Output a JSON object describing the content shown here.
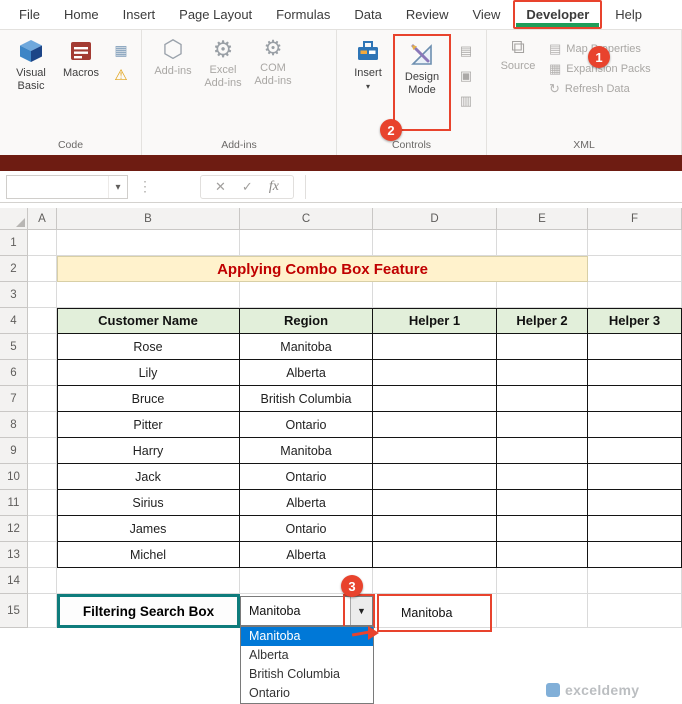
{
  "colors": {
    "accent_red": "#E8432D",
    "excel_green": "#1E9E5A",
    "title_text": "#C00000",
    "title_bg": "#FFF2CC",
    "table_header_bg": "#E2EFDA",
    "selection_blue": "#0078D7",
    "filter_border_teal": "#0E7C7C",
    "window_strip": "#6E1C12"
  },
  "ribbon": {
    "tabs": [
      {
        "label": "File",
        "active": false
      },
      {
        "label": "Home",
        "active": false
      },
      {
        "label": "Insert",
        "active": false
      },
      {
        "label": "Page Layout",
        "active": false
      },
      {
        "label": "Formulas",
        "active": false
      },
      {
        "label": "Data",
        "active": false
      },
      {
        "label": "Review",
        "active": false
      },
      {
        "label": "View",
        "active": false
      },
      {
        "label": "Developer",
        "active": true
      },
      {
        "label": "Help",
        "active": false
      }
    ],
    "groups": [
      {
        "name": "Code",
        "buttons": [
          {
            "label": "Visual Basic",
            "icon": "visual-basic-icon",
            "size": "large",
            "enabled": true
          },
          {
            "label": "Macros",
            "icon": "macros-icon",
            "size": "large",
            "enabled": true
          },
          {
            "label": "",
            "icon": "record-macro-icon",
            "size": "small",
            "enabled": true
          },
          {
            "label": "",
            "icon": "macro-security-icon",
            "size": "small",
            "enabled": true
          }
        ]
      },
      {
        "name": "Add-ins",
        "buttons": [
          {
            "label": "Add-ins",
            "icon": "addins-icon",
            "size": "large",
            "enabled": false
          },
          {
            "label": "Excel Add-ins",
            "icon": "excel-addins-icon",
            "size": "large",
            "enabled": false
          },
          {
            "label": "COM Add-ins",
            "icon": "com-addins-icon",
            "size": "large",
            "enabled": false
          }
        ]
      },
      {
        "name": "Controls",
        "buttons": [
          {
            "label": "Insert",
            "icon": "insert-icon",
            "size": "large",
            "enabled": true,
            "dropdown": true
          },
          {
            "label": "Design Mode",
            "icon": "design-mode-icon",
            "size": "large",
            "enabled": true,
            "highlighted": true
          },
          {
            "label": "",
            "icon": "properties-icon",
            "size": "small",
            "enabled": false
          },
          {
            "label": "",
            "icon": "view-code-icon",
            "size": "small",
            "enabled": false
          },
          {
            "label": "",
            "icon": "run-dialog-icon",
            "size": "small",
            "enabled": false
          }
        ]
      },
      {
        "name": "XML",
        "buttons": [
          {
            "label": "Source",
            "icon": "source-icon",
            "size": "large",
            "enabled": false
          },
          {
            "label": "Map Properties",
            "icon": "map-properties-icon",
            "size": "menu",
            "enabled": false
          },
          {
            "label": "Expansion Packs",
            "icon": "expansion-packs-icon",
            "size": "menu",
            "enabled": false
          },
          {
            "label": "Refresh Data",
            "icon": "refresh-data-icon",
            "size": "menu",
            "enabled": false
          }
        ]
      }
    ]
  },
  "callouts": {
    "step1": "1",
    "step2": "2",
    "step3": "3"
  },
  "formula_bar": {
    "name_box_value": "",
    "cancel": "✕",
    "enter": "✓",
    "fx": "fx",
    "formula_value": ""
  },
  "sheet": {
    "columns": [
      "A",
      "B",
      "C",
      "D",
      "E",
      "F"
    ],
    "row_numbers": [
      1,
      2,
      3,
      4,
      5,
      6,
      7,
      8,
      9,
      10,
      11,
      12,
      13,
      14,
      15
    ],
    "title": "Applying Combo Box Feature",
    "table": {
      "headers": [
        "Customer Name",
        "Region",
        "Helper 1",
        "Helper 2",
        "Helper 3"
      ],
      "rows": [
        [
          "Rose",
          "Manitoba",
          "",
          "",
          ""
        ],
        [
          "Lily",
          "Alberta",
          "",
          "",
          ""
        ],
        [
          "Bruce",
          "British Columbia",
          "",
          "",
          ""
        ],
        [
          "Pitter",
          "Ontario",
          "",
          "",
          ""
        ],
        [
          "Harry",
          "Manitoba",
          "",
          "",
          ""
        ],
        [
          "Jack",
          "Ontario",
          "",
          "",
          ""
        ],
        [
          "Sirius",
          "Alberta",
          "",
          "",
          ""
        ],
        [
          "James",
          "Ontario",
          "",
          "",
          ""
        ],
        [
          "Michel",
          "Alberta",
          "",
          "",
          ""
        ]
      ]
    },
    "filter_label": "Filtering Search Box",
    "combo_box": {
      "value": "Manitoba",
      "options": [
        "Manitoba",
        "Alberta",
        "British Columbia",
        "Ontario"
      ],
      "selected_option": "Manitoba"
    },
    "linked_cell_value": "Manitoba"
  },
  "watermark": {
    "text": "exceldemy"
  }
}
